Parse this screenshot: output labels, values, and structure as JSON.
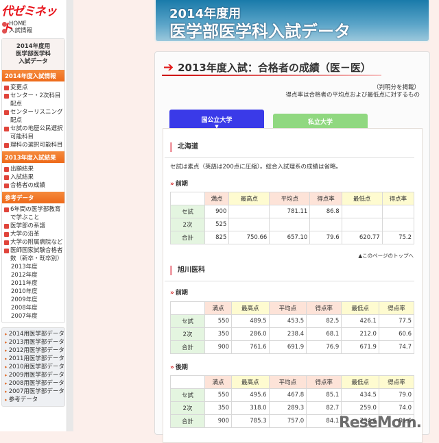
{
  "sidebar": {
    "logo": "代ゼミネット",
    "links": [
      "HOME",
      "入試情報"
    ],
    "box_title": [
      "2014年度用",
      "医学部医学科",
      "入試データ"
    ],
    "sections": [
      {
        "heading": "2014年度入試情報",
        "items": [
          "変更点",
          "センター・2次科目配点",
          "センターリスニング配点",
          "セ試の地歴公民選択可能科目",
          "理科の選択可能科目"
        ]
      },
      {
        "heading": "2013年度入試結果",
        "items": [
          "出願結果",
          "入試結果",
          "合格者の成績"
        ]
      },
      {
        "heading": "参考データ",
        "items": [
          "6年間の医学部教育で学ぶこと",
          "医学部の系譜",
          "大学の沿革",
          "大学の附属病院など",
          "医師国家試験合格者数（新卒・既卒別）"
        ],
        "subitems": [
          "2013年度",
          "2012年度",
          "2011年度",
          "2010年度",
          "2009年度",
          "2008年度",
          "2007年度"
        ]
      }
    ],
    "years": [
      "2014用医学部データ",
      "2013用医学部データ",
      "2012用医学部データ",
      "2011用医学部データ",
      "2010用医学部データ",
      "2009用医学部データ",
      "2008用医学部データ",
      "2007用医学部データ",
      "参考データ"
    ]
  },
  "banner": {
    "line1": "2014年度用",
    "line2": "医学部医学科入試データ"
  },
  "page": {
    "title": "2013年度入試：合格者の成績（医－医）",
    "note1": "（判明分を掲載）",
    "note2": "得点率は合格者の平均点および最低点に対するもの",
    "tabs": [
      "国公立大学",
      "私立大学"
    ],
    "columns": [
      "満点",
      "最高点",
      "平均点",
      "得点率",
      "最低点",
      "得点率"
    ],
    "to_top": "▲このページのトップへ",
    "universities": [
      {
        "name": "北海道",
        "note": "セ試は素点（英語は200点に圧縮）。総合入試理系の成績は省略。",
        "terms": [
          {
            "name": "前期",
            "rows": [
              [
                "セ試",
                "900",
                "",
                "781.11",
                "86.8",
                "",
                ""
              ],
              [
                "2次",
                "525",
                "",
                "",
                "",
                "",
                ""
              ],
              [
                "合計",
                "825",
                "750.66",
                "657.10",
                "79.6",
                "620.77",
                "75.2"
              ]
            ]
          }
        ]
      },
      {
        "name": "旭川医科",
        "terms": [
          {
            "name": "前期",
            "rows": [
              [
                "セ試",
                "550",
                "489.5",
                "453.5",
                "82.5",
                "426.1",
                "77.5"
              ],
              [
                "2次",
                "350",
                "286.0",
                "238.4",
                "68.1",
                "212.0",
                "60.6"
              ],
              [
                "合計",
                "900",
                "761.6",
                "691.9",
                "76.9",
                "671.9",
                "74.7"
              ]
            ]
          },
          {
            "name": "後期",
            "rows": [
              [
                "セ試",
                "550",
                "495.6",
                "467.8",
                "85.1",
                "434.5",
                "79.0"
              ],
              [
                "2次",
                "350",
                "318.0",
                "289.3",
                "82.7",
                "259.0",
                "74.0"
              ],
              [
                "合計",
                "900",
                "785.3",
                "757.0",
                "84.1",
                "734.6",
                "81.6"
              ]
            ]
          }
        ]
      }
    ]
  },
  "watermark": "ReseMom"
}
